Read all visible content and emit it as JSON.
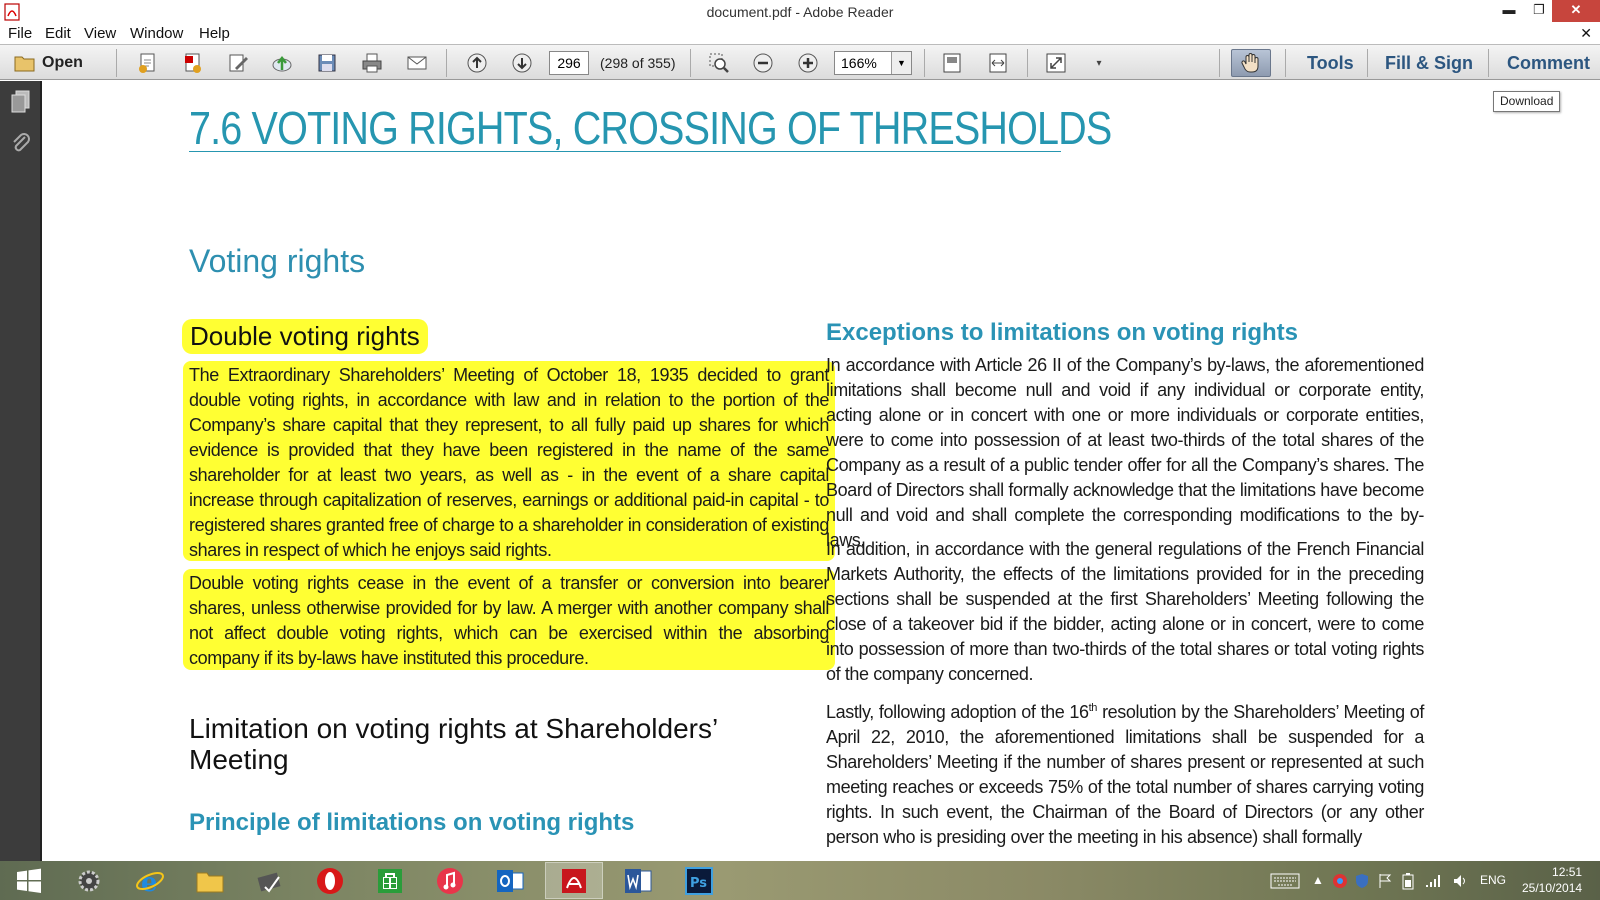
{
  "window": {
    "title": "document.pdf - Adobe Reader",
    "minimize": "▬",
    "maximize": "❐",
    "close": "✕"
  },
  "menu": {
    "items": [
      "File",
      "Edit",
      "View",
      "Window",
      "Help"
    ],
    "close_doc": "✕"
  },
  "toolbar": {
    "open_label": "Open",
    "page_number": "296",
    "page_count": "(298 of 355)",
    "zoom": "166%",
    "tools_label": "Tools",
    "fill_sign_label": "Fill & Sign",
    "comment_label": "Comment",
    "icons": [
      "folder-icon",
      "create-pdf-icon",
      "export-pdf-icon",
      "edit-icon",
      "upload-icon",
      "save-icon",
      "print-icon",
      "email-icon",
      "page-up-icon",
      "page-down-icon",
      "zoom-select-icon",
      "zoom-out-icon",
      "zoom-in-icon",
      "fit-page-icon",
      "fit-width-icon",
      "fullscreen-icon",
      "hand-tool-icon"
    ]
  },
  "tooltip": "Download",
  "document": {
    "section_heading": "7.6  VOTING RIGHTS, CROSSING OF THRESHOLDS",
    "voting_rights_heading": "Voting rights",
    "double_heading": "Double voting rights",
    "para_a": "The Extraordinary Shareholders’ Meeting of October 18, 1935 decided to grant double voting rights, in accordance with law and in relation to the portion of the Company’s share capital that they represent, to all fully paid up shares for which evidence is provided that they have been registered in the name of the same shareholder for at least two years, as well as - in the event of a share capital increase through capitalization of reserves, earnings or additional paid-in capital - to registered shares granted free of charge to a shareholder in consideration of existing shares in respect of which he enjoys said rights.",
    "para_b": "Double voting rights cease in the event of a transfer or conversion into bearer shares, unless otherwise provided for by law. A merger with another company shall not affect double voting rights, which can be exercised within the absorbing company if its by-laws have instituted this procedure.",
    "limit_heading": "Limitation on voting rights at Shareholders’ Meeting",
    "principle_heading": "Principle of limitations on voting rights",
    "except_heading": "Exceptions to limitations on voting rights",
    "para_c": "In accordance with Article 26 II of the Company’s by-laws, the aforementioned limitations shall become null and void if any individual or corporate entity, acting alone or in concert with one or more individuals or corporate entities, were to come into possession of at least two-thirds of the total shares of the Company as a result of a public tender offer for all the Company’s shares. The Board of Directors shall formally acknowledge that the limitations have become null and void and shall complete the corresponding modifications to the by-laws.",
    "para_d": "In addition, in accordance with the general regulations of the French Financial Markets Authority, the effects of the limitations provided for in the preceding sections shall be suspended at the first Shareholders’ Meeting following the close of a takeover bid if the bidder, acting alone or in concert, were to come into possession of more than two-thirds of the total shares or total voting rights of the company concerned.",
    "para_e_pre": "Lastly, following adoption of the 16",
    "para_e_sup": "th",
    "para_e_post": " resolution by the Shareholders’ Meeting of April 22, 2010, the aforementioned limitations shall be suspended for a Shareholders’ Meeting if the number of shares present or represented at such meeting reaches or exceeds 75% of the total number of shares carrying voting rights. In such event, the Chairman of the Board of Directors (or any other person who is presiding over the meeting in his absence) shall formally"
  },
  "taskbar": {
    "apps": [
      "windows-start-icon",
      "settings-app-icon",
      "internet-explorer-icon",
      "file-explorer-icon",
      "mail-app-icon",
      "opera-icon",
      "store-icon",
      "itunes-icon",
      "outlook-icon",
      "adobe-reader-icon",
      "word-icon",
      "photoshop-icon"
    ],
    "language": "ENG",
    "time": "12:51",
    "date": "25/10/2014"
  },
  "colors": {
    "accent": "#2696b0",
    "highlight": "#ffff33",
    "close_button": "#c7453d"
  }
}
